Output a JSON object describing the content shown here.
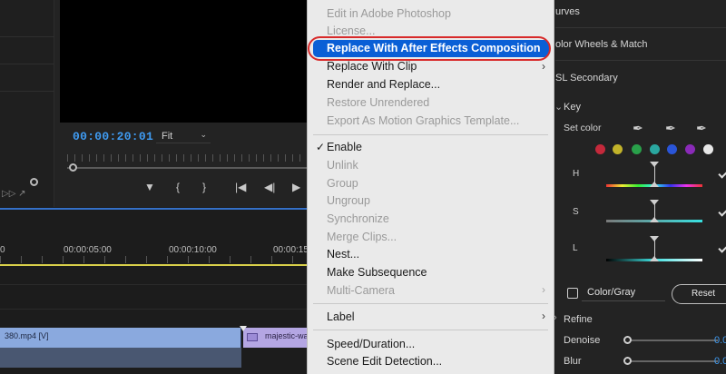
{
  "monitor": {
    "timecode": "00:00:20:01",
    "fit_value": "Fit"
  },
  "timeline": {
    "ruler": [
      "0",
      "00:00:05:00",
      "00:00:10:00",
      "00:00:15"
    ],
    "clips": {
      "clip_a": "380.mp4 [V]",
      "clip_b": "majestic-wa"
    }
  },
  "context_menu": {
    "items": [
      {
        "label": "Edit in Adobe Photoshop",
        "enabled": false
      },
      {
        "label": "License...",
        "enabled": false
      },
      {
        "label": "Replace With After Effects Composition",
        "enabled": true,
        "highlighted": true
      },
      {
        "label": "Replace With Clip",
        "enabled": true,
        "submenu": true
      },
      {
        "label": "Render and Replace...",
        "enabled": true
      },
      {
        "label": "Restore Unrendered",
        "enabled": false
      },
      {
        "label": "Export As Motion Graphics Template...",
        "enabled": false
      },
      {
        "label": "Enable",
        "enabled": true,
        "checked": true
      },
      {
        "label": "Unlink",
        "enabled": false
      },
      {
        "label": "Group",
        "enabled": false
      },
      {
        "label": "Ungroup",
        "enabled": false
      },
      {
        "label": "Synchronize",
        "enabled": false
      },
      {
        "label": "Merge Clips...",
        "enabled": false
      },
      {
        "label": "Nest...",
        "enabled": true
      },
      {
        "label": "Make Subsequence",
        "enabled": true
      },
      {
        "label": "Multi-Camera",
        "enabled": false,
        "submenu": true
      },
      {
        "label": "Label",
        "enabled": true,
        "submenu": true
      },
      {
        "label": "Speed/Duration...",
        "enabled": true
      },
      {
        "label": "Scene Edit Detection...",
        "enabled": true
      }
    ]
  },
  "lumetri": {
    "sections": {
      "curves": "urves",
      "color_wheels": "olor Wheels & Match",
      "hsl_secondary": "SL Secondary",
      "key": "Key",
      "set_color": "Set color",
      "refine": "Refine"
    },
    "hsl": {
      "h": "H",
      "s": "S",
      "l": "L"
    },
    "swatch_colors": [
      "#c4293b",
      "#c2b32a",
      "#29a04a",
      "#2aa7a0",
      "#2a55d8",
      "#8a2ab8",
      "#e8e8e8"
    ],
    "color_gray": "Color/Gray",
    "reset_label": "Reset",
    "denoise": {
      "label": "Denoise",
      "value": "0.0"
    },
    "blur": {
      "label": "Blur",
      "value": "0.0"
    }
  }
}
